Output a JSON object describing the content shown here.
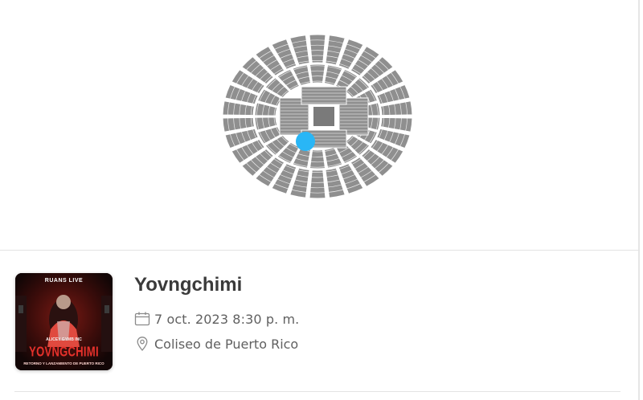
{
  "seat_map": {
    "marker_color": "#29b6f6",
    "seat_color": "#8f8f8f",
    "stage_color": "#7a7a7a"
  },
  "event": {
    "title": "Yovngchimi",
    "date": "7 oct. 2023 8:30 p. m.",
    "venue": "Coliseo de Puerto Rico",
    "poster": {
      "top_text": "RUANS LIVE",
      "subtitle": "ALICEY GYMB INC",
      "name": "YOVNGCHIMI",
      "tagline": "RETORNO Y LANZAMIENTO DE PUERTO RICO"
    },
    "icons": {
      "date": "calendar-icon",
      "venue": "location-pin-icon"
    }
  }
}
